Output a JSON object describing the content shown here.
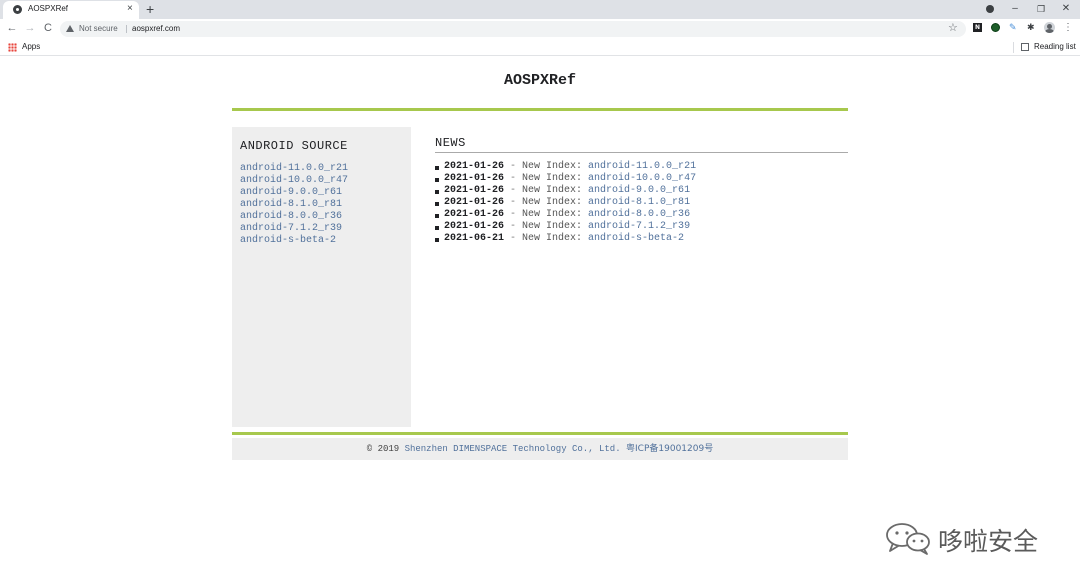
{
  "browser": {
    "tab": {
      "title": "AOSPXRef",
      "close_glyph": "×"
    },
    "new_tab_glyph": "+",
    "window_controls": {
      "minimize": "–",
      "maximize": "❐",
      "close": "✕"
    },
    "toolbar": {
      "back_glyph": "←",
      "forward_glyph": "→",
      "reload_glyph": "C",
      "security_label": "Not secure",
      "url": "aospxref.com",
      "bookmark_glyph": "☆",
      "extension_n_label": "N",
      "extension_pen_glyph": "✎",
      "extension_puzzle_glyph": "✱",
      "menu_glyph": "⋮"
    },
    "bookmarks_bar": {
      "apps_label": "Apps",
      "reading_list_label": "Reading list"
    }
  },
  "site": {
    "title": "AOSPXRef",
    "sidebar": {
      "heading": "ANDROID SOURCE",
      "items": [
        "android-11.0.0_r21",
        "android-10.0.0_r47",
        "android-9.0.0_r61",
        "android-8.1.0_r81",
        "android-8.0.0_r36",
        "android-7.1.2_r39",
        "android-s-beta-2"
      ]
    },
    "news": {
      "heading": "NEWS",
      "separator": " - ",
      "items": [
        {
          "date": "2021-01-26",
          "label": "New Index: ",
          "link": "android-11.0.0_r21"
        },
        {
          "date": "2021-01-26",
          "label": "New Index: ",
          "link": "android-10.0.0_r47"
        },
        {
          "date": "2021-01-26",
          "label": "New Index: ",
          "link": "android-9.0.0_r61"
        },
        {
          "date": "2021-01-26",
          "label": "New Index: ",
          "link": "android-8.1.0_r81"
        },
        {
          "date": "2021-01-26",
          "label": "New Index: ",
          "link": "android-8.0.0_r36"
        },
        {
          "date": "2021-01-26",
          "label": "New Index: ",
          "link": "android-7.1.2_r39"
        },
        {
          "date": "2021-06-21",
          "label": "New Index: ",
          "link": "android-s-beta-2"
        }
      ]
    },
    "footer": {
      "copyright": "© 2019 ",
      "company": "Shenzhen DIMENSPACE Technology Co., Ltd.",
      "icp": "粤ICP备19001209号"
    },
    "colors": {
      "accent_rule": "#a7c84d",
      "link": "#51719b",
      "panel_bg": "#eeeeee"
    }
  },
  "watermark": {
    "text": "哆啦安全"
  }
}
